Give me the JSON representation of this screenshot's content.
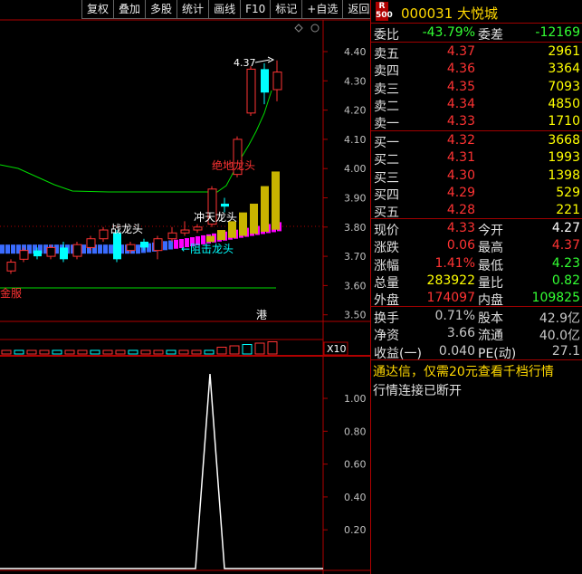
{
  "toolbar": {
    "buttons": [
      "复权",
      "叠加",
      "多股",
      "统计",
      "画线",
      "F10",
      "标记",
      "+自选",
      "返回"
    ]
  },
  "chart": {
    "price_axis": [
      "4.40",
      "4.30",
      "4.20",
      "4.10",
      "4.00",
      "3.90",
      "3.80",
      "3.70",
      "3.60",
      "3.50"
    ],
    "indicator_axis": [
      "1.00",
      "0.80",
      "0.60",
      "0.40",
      "0.20"
    ],
    "peak_label": "4.37",
    "labels": {
      "jzlt": "绝地龙头",
      "zzlt": "战龙头",
      "cxlt": "冲天龙头",
      "zjlt": "←阻击龙头",
      "jinfu": "金服",
      "gang": "港",
      "x10": "X10"
    },
    "colors": {
      "up": "#ff3333",
      "down": "#00ffff",
      "volume_yellow": "#c8b400",
      "green_line": "#00dd00",
      "magenta_line": "#ff00ff",
      "blue_bar": "#3a6cff"
    }
  },
  "quote": {
    "badge": "R\n500",
    "code_name": "000031 大悦城",
    "weibi": {
      "label": "委比",
      "value": "-43.79%",
      "label2": "委差",
      "value2": "-12169"
    },
    "sells": [
      {
        "label": "卖五",
        "price": "4.37",
        "vol": "2961"
      },
      {
        "label": "卖四",
        "price": "4.36",
        "vol": "3364"
      },
      {
        "label": "卖三",
        "price": "4.35",
        "vol": "7093"
      },
      {
        "label": "卖二",
        "price": "4.34",
        "vol": "4850"
      },
      {
        "label": "卖一",
        "price": "4.33",
        "vol": "1710"
      }
    ],
    "buys": [
      {
        "label": "买一",
        "price": "4.32",
        "vol": "3668"
      },
      {
        "label": "买二",
        "price": "4.31",
        "vol": "1993"
      },
      {
        "label": "买三",
        "price": "4.30",
        "vol": "1398"
      },
      {
        "label": "买四",
        "price": "4.29",
        "vol": "529"
      },
      {
        "label": "买五",
        "price": "4.28",
        "vol": "221"
      }
    ],
    "stats1": [
      {
        "l1": "现价",
        "v1": "4.33",
        "l2": "今开",
        "v2": "4.27"
      },
      {
        "l1": "涨跌",
        "v1": "0.06",
        "l2": "最高",
        "v2": "4.37"
      },
      {
        "l1": "涨幅",
        "v1": "1.41%",
        "l2": "最低",
        "v2": "4.23"
      },
      {
        "l1": "总量",
        "v1": "283922",
        "l2": "量比",
        "v2": "0.82"
      },
      {
        "l1": "外盘",
        "v1": "174097",
        "l2": "内盘",
        "v2": "109825"
      }
    ],
    "stats2": [
      {
        "l1": "换手",
        "v1": "0.71%",
        "l2": "股本",
        "v2": "42.9亿"
      },
      {
        "l1": "净资",
        "v1": "3.66",
        "l2": "流通",
        "v2": "40.0亿"
      },
      {
        "l1": "收益(一)",
        "v1": "0.040",
        "l2": "PE(动)",
        "v2": "27.1"
      }
    ],
    "notice": "通达信，仅需20元查看千档行情",
    "notice2": "行情连接已断开"
  }
}
